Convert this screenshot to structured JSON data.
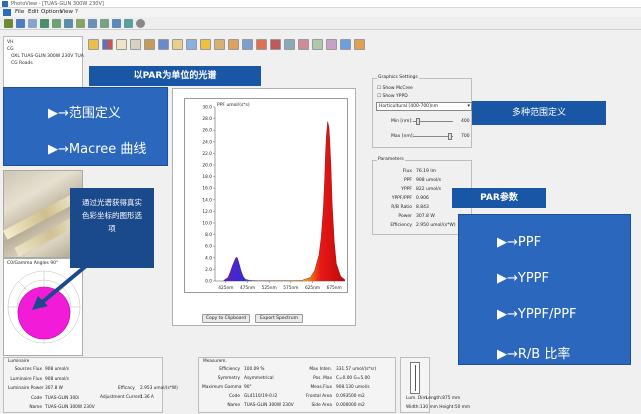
{
  "window": {
    "title": "PhotoView - [TUAS-GLIN 300W 230V]"
  },
  "menu": [
    "File",
    "Edit",
    "Options",
    "View",
    "?"
  ],
  "tree": {
    "items": [
      "VH",
      "CG",
      "OXL TUAS-GLIN 300W 230V TUA",
      "CG Roads"
    ]
  },
  "polar": {
    "title": "C0/Gamma Angles 90°"
  },
  "chart": {
    "ylabel": "PPF umol/(s*s)",
    "copy_button": "Copy to Clipboard",
    "export_button": "Export Spectrum"
  },
  "chart_data": {
    "type": "area",
    "ylabel": "PPF umol/(s*s)",
    "xlabel": "",
    "ylim": [
      0,
      30
    ],
    "xlim": [
      400,
      700
    ],
    "yticks": [
      "0.0",
      "2.0",
      "4.0",
      "6.0",
      "8.0",
      "10.0",
      "12.0",
      "14.0",
      "16.0",
      "18.0",
      "20.0",
      "22.0",
      "24.0",
      "26.0",
      "28.0",
      "30.0"
    ],
    "xticks": [
      "425nm",
      "475nm",
      "525nm",
      "575nm",
      "625nm",
      "675nm"
    ],
    "series": [
      {
        "x": [
          420,
          430,
          435,
          440,
          445,
          448,
          450,
          452,
          455,
          460,
          465,
          470,
          480,
          500,
          550,
          600,
          620,
          630,
          640,
          645,
          650,
          653,
          655,
          657,
          660,
          663,
          665,
          668,
          670,
          675,
          680,
          690,
          700
        ],
        "y": [
          0.1,
          0.6,
          1.5,
          2.6,
          3.5,
          4.0,
          4.1,
          3.9,
          3.2,
          1.8,
          0.8,
          0.3,
          0.1,
          0.05,
          0.05,
          0.1,
          0.6,
          1.8,
          4.5,
          7.5,
          12.5,
          17.5,
          22.0,
          25.0,
          27.5,
          26.5,
          24.0,
          19.0,
          14.0,
          7.0,
          3.0,
          0.8,
          0.2
        ]
      }
    ]
  },
  "graphics_settings": {
    "legend": "Graphics Settings",
    "show_mccree": "Show McCree",
    "show_yppd": "Show YPPD",
    "dropdown_value": "Horticultural [400-700]nm",
    "min_label": "Min [nm]:",
    "min_value": "400",
    "max_label": "Max [nm]:",
    "max_value": "700"
  },
  "parameters": {
    "legend": "Parameters",
    "rows": [
      {
        "label": "Flux",
        "value": "76.19 lm"
      },
      {
        "label": "PPF",
        "value": "908 umol/s"
      },
      {
        "label": "YPPF",
        "value": "822 umol/s"
      },
      {
        "label": "YPPF/PPF",
        "value": "0.906"
      },
      {
        "label": "R/B Ratio",
        "value": "8.843"
      },
      {
        "label": "Power",
        "value": "307.8 W"
      },
      {
        "label": "Efficiency",
        "value": "2.950 umol/(s*W)"
      }
    ]
  },
  "luminaire": {
    "title": "Luminaire",
    "rows": [
      {
        "label": "Sources Flux",
        "value": "908 umol/s"
      },
      {
        "label": "Luminaire Flux",
        "value": "908 umol/s"
      },
      {
        "label": "Luminaire Power",
        "value": "307.8 W"
      },
      {
        "label": "Code",
        "value": "TUAS-GLIN 300i"
      },
      {
        "label": "Name",
        "value": "TUAS-GLIN 300W 230V"
      }
    ],
    "efficacy_label": "Efficacy",
    "efficacy_value": "2.953 umol/(s*W)",
    "adj_label": "Adjustment Current",
    "adj_value": "1.36 A"
  },
  "measurement": {
    "title": "Measurem.",
    "rows": [
      {
        "label": "Efficiency",
        "value": "100.09 %"
      },
      {
        "label": "Symmetry",
        "value": "Asymmetrical"
      },
      {
        "label": "Maximum Gamma",
        "value": "90°"
      },
      {
        "label": "Code",
        "value": "GL4110/19-0.I2"
      },
      {
        "label": "Name",
        "value": "TUAS-GLIN 300W 230V"
      }
    ],
    "rows2": [
      {
        "label": "Max Inten.",
        "value": "331.57 umol/(s*sr)"
      },
      {
        "label": "Pos. Max",
        "value": "C=0.00 G=5.00"
      },
      {
        "label": "Meas.Flux",
        "value": "908.130 umol/s"
      },
      {
        "label": "Frontal Area",
        "value": "0.093500 m2"
      },
      {
        "label": "Side Area",
        "value": "0.000000 m2"
      }
    ]
  },
  "dimensions": {
    "lum_dim": "Lum. Dim.",
    "length": "Length:875 mm",
    "width_height": "Width:130 mm Height:50 mm"
  },
  "callouts": {
    "par_title": "以PAR为单位的光谱",
    "range_definition": "▶→范围定义",
    "mccree_curve": "▶→Macree 曲线",
    "multiple_ranges": "多种范围定义",
    "par_params_title": "PAR参数",
    "ppf": "▶→PPF",
    "yppf": "▶→YPPF",
    "yppf_ppf": "▶→YPPF/PPF",
    "rb_ratio": "▶→R/B 比率",
    "chromaticity": "通过光谱获得真实色彩坐标的图形选项"
  },
  "colors": {
    "callout_blue": "#2a67bd",
    "title_blue": "#1a56a6",
    "blue_spectrum": "#2a30d8",
    "red_spectrum": "#e81818",
    "polar_fill": "#f21bd7"
  }
}
